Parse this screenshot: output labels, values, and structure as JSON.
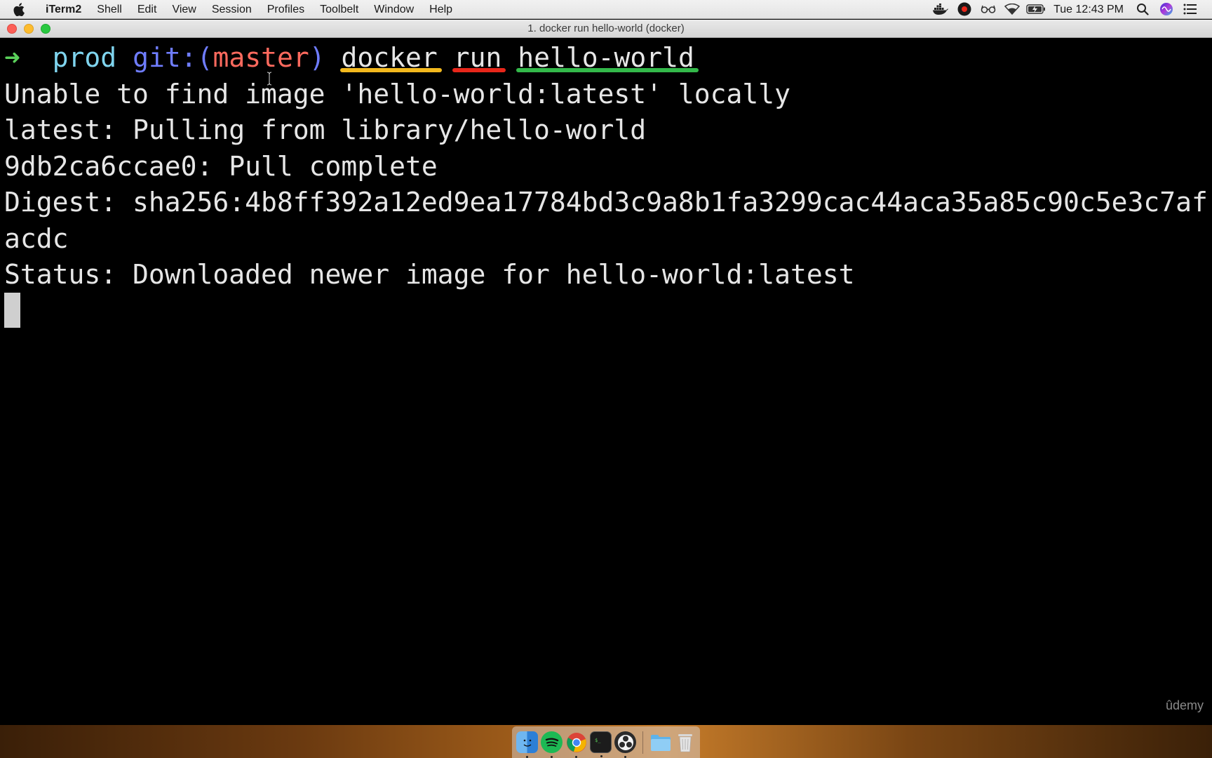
{
  "menubar": {
    "app_name": "iTerm2",
    "menus": [
      "Shell",
      "Edit",
      "View",
      "Session",
      "Profiles",
      "Toolbelt",
      "Window",
      "Help"
    ],
    "clock": "Tue 12:43 PM"
  },
  "window": {
    "title": "1. docker run hello-world (docker)"
  },
  "terminal": {
    "prompt_arrow": "➜",
    "prompt_dir": "prod",
    "prompt_git_prefix": "git:(",
    "prompt_branch": "master",
    "prompt_git_suffix": ")",
    "command": [
      "docker",
      "run",
      "hello-world"
    ],
    "underline_colors": [
      "#f3b91e",
      "#e8261a",
      "#33b84a"
    ],
    "output": [
      "Unable to find image 'hello-world:latest' locally",
      "latest: Pulling from library/hello-world",
      "9db2ca6ccae0: Pull complete",
      "Digest: sha256:4b8ff392a12ed9ea17784bd3c9a8b1fa3299cac44aca35a85c90c5e3c7af",
      "acdc",
      "Status: Downloaded newer image for hello-world:latest"
    ]
  },
  "watermark": "ûdemy"
}
